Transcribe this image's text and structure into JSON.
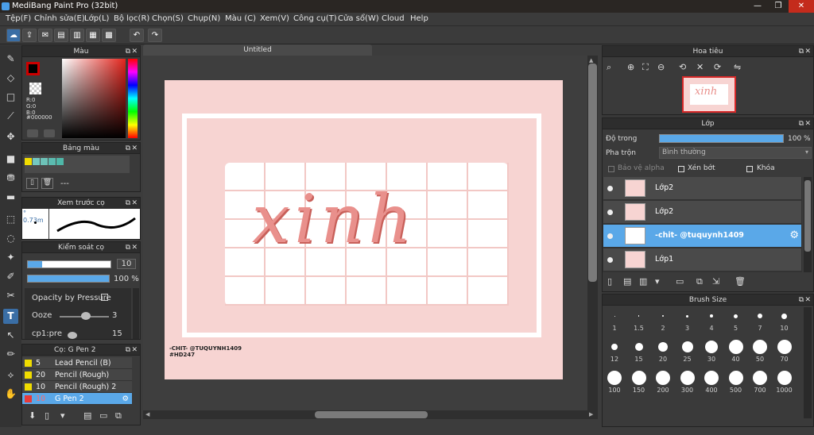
{
  "app": {
    "title": "MediBang Paint Pro (32bit)"
  },
  "menu": [
    "Tệp(F)",
    "Chỉnh sửa(E)",
    "Lớp(L)",
    "Bộ lọc(R)",
    "Chọn(S)",
    "Chụp(N)",
    "Màu (C)",
    "Xem(V)",
    "Công cụ(T)",
    "Cửa sổ(W)",
    "Cloud",
    "Help"
  ],
  "document": {
    "tab_title": "Untitled"
  },
  "color_panel": {
    "title": "Màu",
    "r": "R:0",
    "g": "G:0",
    "b": "B:0",
    "hex": "#000000"
  },
  "palette_panel": {
    "title": "Bảng màu",
    "more": "---",
    "swatches": [
      "#f0dc00",
      "#73c7c0",
      "#6dc2b8",
      "#5bbbb0",
      "#4fb7a8"
    ]
  },
  "brush_preview": {
    "title": "Xem trước cọ",
    "size": "0.73m"
  },
  "brush_control": {
    "title": "Kiểm soát cọ",
    "size": "10",
    "opacity": "100 %",
    "opacity_pressure_label": "Opacity by Pressure",
    "ooze_label": "Ooze",
    "ooze_value": "3",
    "cp_label": "cp1:pre",
    "cp_value": "15"
  },
  "brush_panel": {
    "title": "Cọ: G Pen 2",
    "items": [
      {
        "num": "5",
        "label": "Lead Pencil (B)",
        "color": "#f0dc00"
      },
      {
        "num": "20",
        "label": "Pencil (Rough)",
        "color": "#f0dc00"
      },
      {
        "num": "10",
        "label": "Pencil (Rough) 2",
        "color": "#f0dc00"
      },
      {
        "num": "10",
        "label": "G Pen 2",
        "color": "#e83a3a",
        "active": true
      }
    ]
  },
  "canvas": {
    "headline": "xinh",
    "credit": "-CHIT-  @TUQUYNH1409",
    "tag": "#HD247"
  },
  "navigator": {
    "title": "Hoa tiêu"
  },
  "layer_panel": {
    "title": "Lớp",
    "opacity_label": "Độ trong",
    "opacity_value": "100 %",
    "blend_label": "Pha trộn",
    "blend_value": "Bình thường",
    "protect_alpha": "Bảo vệ alpha",
    "clip": "Xén bớt",
    "lock": "Khóa",
    "layers": [
      {
        "name": "Lớp2",
        "active": false
      },
      {
        "name": "Lớp2",
        "active": false
      },
      {
        "name": "-chit-  @tuquynh1409",
        "active": true
      },
      {
        "name": "Lớp1",
        "active": false
      }
    ]
  },
  "brush_size": {
    "title": "Brush Size",
    "sizes": [
      "1",
      "1.5",
      "2",
      "3",
      "4",
      "5",
      "7",
      "10",
      "12",
      "15",
      "20",
      "25",
      "30",
      "40",
      "50",
      "70",
      "100",
      "150",
      "200",
      "300",
      "400",
      "500",
      "700",
      "1000"
    ]
  }
}
